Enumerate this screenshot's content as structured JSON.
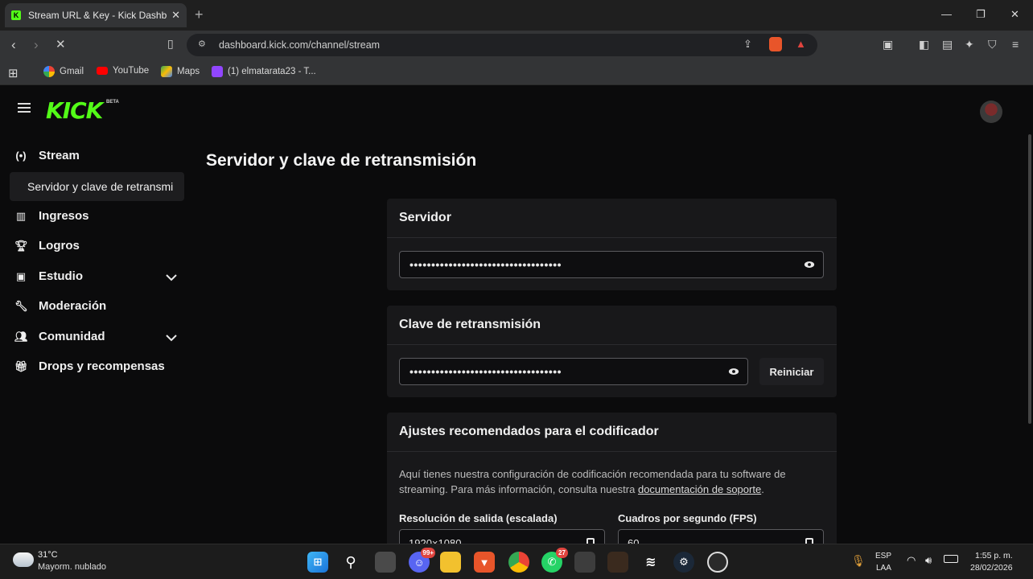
{
  "browser": {
    "tab_title": "Stream URL & Key - Kick Dashbo",
    "url": "dashboard.kick.com/channel/stream",
    "bookmarks": [
      "Gmail",
      "YouTube",
      "Maps",
      "(1) elmatarata23 - T..."
    ]
  },
  "header": {
    "logo": "KICK",
    "logo_badge": "BETA"
  },
  "sidebar": {
    "items": [
      {
        "label": "Stream",
        "icon": "broadcast-icon"
      },
      {
        "label": "Servidor y clave de retransmi",
        "icon": ""
      },
      {
        "label": "Ingresos",
        "icon": "chart-icon"
      },
      {
        "label": "Logros",
        "icon": "trophy-icon"
      },
      {
        "label": "Estudio",
        "icon": "studio-icon"
      },
      {
        "label": "Moderación",
        "icon": "wrench-icon"
      },
      {
        "label": "Comunidad",
        "icon": "people-icon"
      },
      {
        "label": "Drops y recompensas",
        "icon": "gift-icon"
      }
    ]
  },
  "main": {
    "title": "Servidor y clave de retransmisión",
    "server": {
      "heading": "Servidor",
      "masked_value": "•••••••••••••••••••••••••••••••••••"
    },
    "stream_key": {
      "heading": "Clave de retransmisión",
      "masked_value": "•••••••••••••••••••••••••••••••••••",
      "reset_label": "Reiniciar"
    },
    "encoder": {
      "heading": "Ajustes recomendados para el codificador",
      "desc_line1": "Aquí tienes nuestra configuración de codificación recomendada para tu software de",
      "desc_line2_prefix": "streaming. Para más información, consulta nuestra ",
      "desc_link": "documentación de soporte",
      "desc_suffix": ".",
      "resolution_label": "Resolución de salida (escalada)",
      "resolution_value": "1920×1080",
      "fps_label": "Cuadros por segundo (FPS)",
      "fps_value": "60"
    }
  },
  "taskbar": {
    "weather_temp": "31°C",
    "weather_desc": "Mayorm. nublado",
    "discord_badge": "99+",
    "whatsapp_badge": "27",
    "lang_top": "ESP",
    "lang_bottom": "LAA",
    "time": "1:55 p. m.",
    "date": "28/02/2026"
  },
  "colors": {
    "kick_green": "#53fc18",
    "background": "#0b0b0c",
    "card": "#18181a"
  }
}
